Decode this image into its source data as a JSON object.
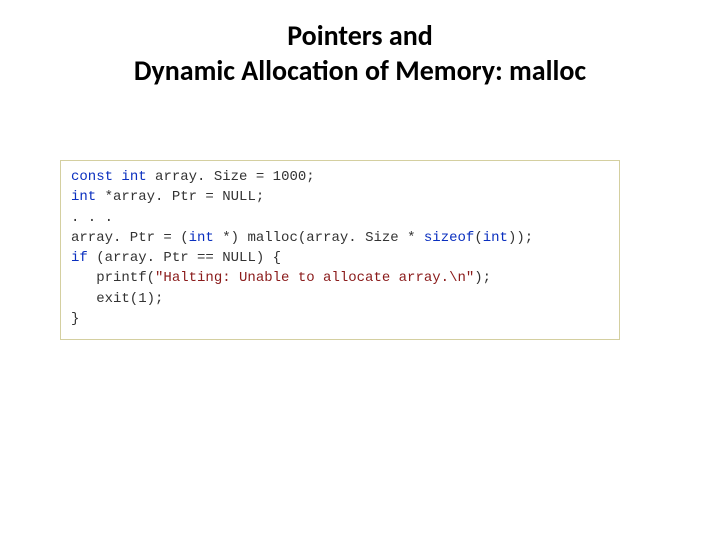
{
  "title": {
    "line1": "Pointers and",
    "line2": "Dynamic Allocation of Memory: malloc"
  },
  "code": {
    "l1": {
      "kw1": "const",
      "kw2": "int",
      "name": " array. Size = ",
      "val": "1000",
      "end": ";"
    },
    "l2": {
      "kw1": "int",
      "rest": " *array. Ptr = NULL;"
    },
    "l3": ". . .",
    "l4": {
      "a": "array. Ptr = (",
      "kw1": "int",
      "b": " *) malloc(array. Size * ",
      "kw2": "sizeof",
      "c": "(",
      "kw3": "int",
      "d": "));"
    },
    "l5": {
      "kw1": "if",
      "rest": " (array. Ptr == NULL) {"
    },
    "l6": {
      "indent": "   printf(",
      "str": "\"Halting: Unable to allocate array.\\n\"",
      "end": ");"
    },
    "l7": "   exit(1);",
    "l8": "}"
  }
}
